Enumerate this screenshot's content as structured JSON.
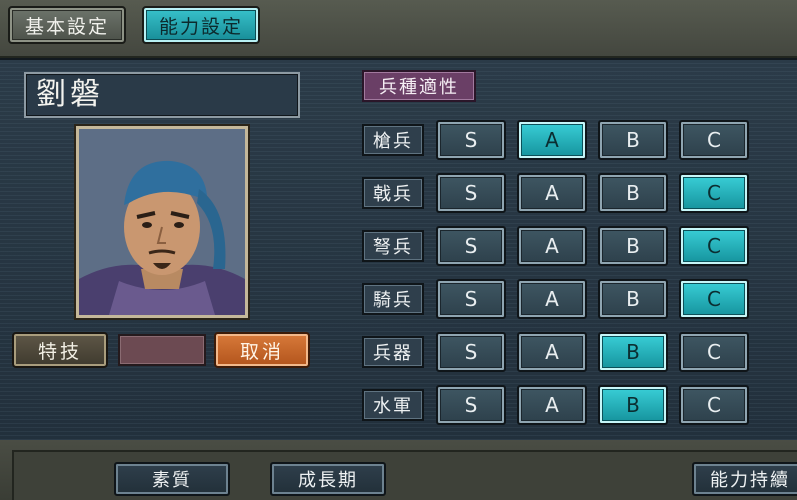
{
  "tabs": {
    "basic": "基本設定",
    "ability": "能力設定",
    "selected": "ability"
  },
  "officer": {
    "name": "劉磐"
  },
  "skill": {
    "button": "特技",
    "value": "",
    "cancel": "取消"
  },
  "aptitude": {
    "header": "兵種適性",
    "grades": [
      "S",
      "A",
      "B",
      "C"
    ],
    "units": [
      {
        "label": "槍兵",
        "selected": "A"
      },
      {
        "label": "戟兵",
        "selected": "C"
      },
      {
        "label": "弩兵",
        "selected": "C"
      },
      {
        "label": "騎兵",
        "selected": "C"
      },
      {
        "label": "兵器",
        "selected": "B"
      },
      {
        "label": "水軍",
        "selected": "B"
      }
    ]
  },
  "bottom": {
    "quality": "素質",
    "growth": "成長期",
    "ability_keep": "能力持續"
  },
  "colors": {
    "selected": "#2bb5bf",
    "cancel": "#c8662a",
    "aptitude_header": "#6a3f66",
    "skill_field": "#6c4a52"
  }
}
